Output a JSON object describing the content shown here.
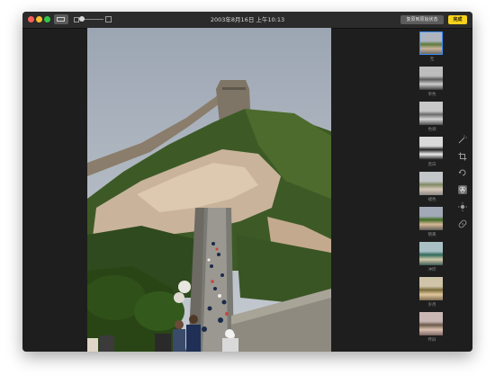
{
  "window": {
    "title": "2003年8月16日 上午10:13"
  },
  "toolbar": {
    "revert_label": "复原到原始状态",
    "done_label": "完成"
  },
  "filters": [
    {
      "label": "无"
    },
    {
      "label": "单色"
    },
    {
      "label": "色调"
    },
    {
      "label": "黑白"
    },
    {
      "label": "褪色"
    },
    {
      "label": "铬黄"
    },
    {
      "label": "冲印"
    },
    {
      "label": "岁月"
    },
    {
      "label": "怀旧"
    }
  ],
  "colors": {
    "accent": "#f6d21c",
    "selection": "#3a8ef6",
    "background": "#1e1e1e"
  },
  "tools": [
    "magic-wand-icon",
    "crop-icon",
    "filters-icon",
    "adjust-icon",
    "retouch-icon",
    "bandage-icon"
  ]
}
